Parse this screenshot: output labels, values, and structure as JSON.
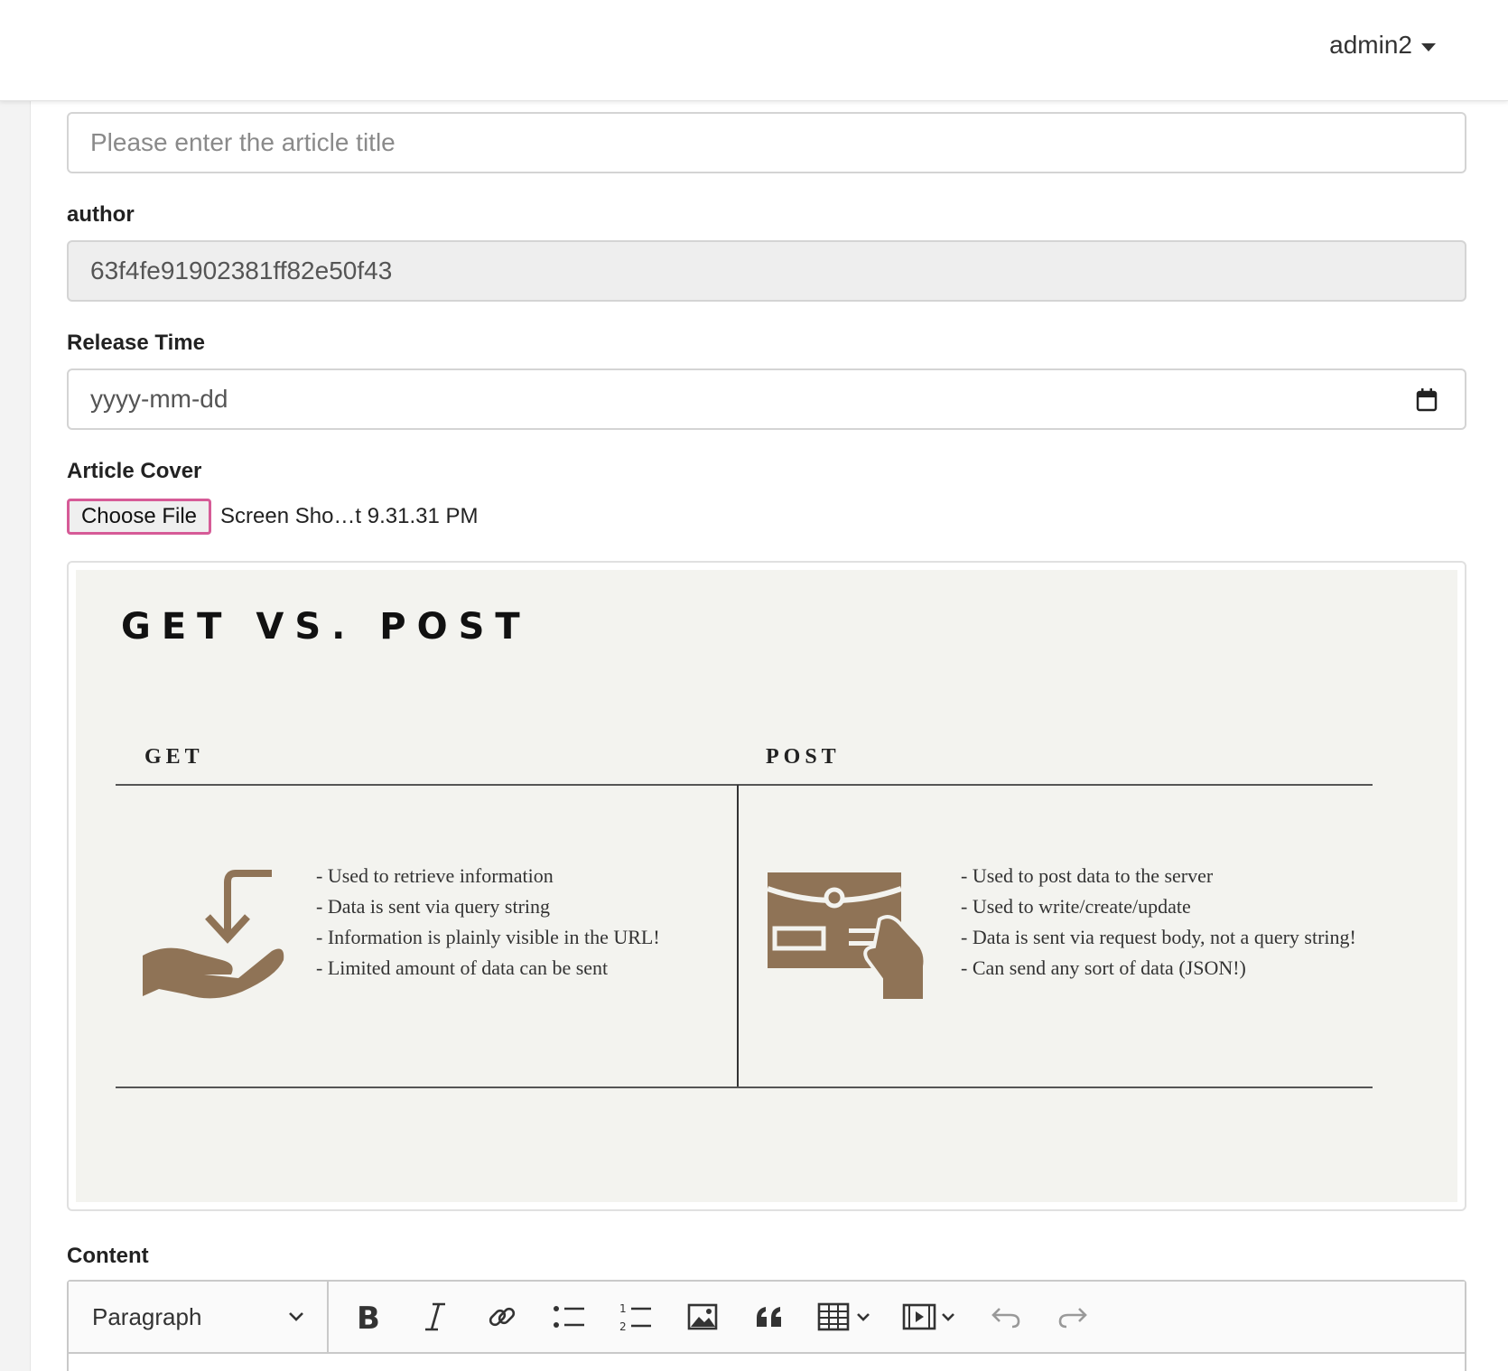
{
  "header": {
    "user": "admin2"
  },
  "form": {
    "title_placeholder": "Please enter the article title",
    "author_label": "author",
    "author_value": "63f4fe91902381ff82e50f43",
    "release_label": "Release Time",
    "release_placeholder": "yyyy-mm-dd",
    "cover_label": "Article Cover",
    "choose_file": "Choose File",
    "file_name": "Screen Sho…t 9.31.31 PM",
    "content_label": "Content"
  },
  "cover_image": {
    "title": "GET VS. POST",
    "get_heading": "GET",
    "post_heading": "POST",
    "get_points": [
      "- Used to retrieve information",
      "- Data is sent via query string",
      "- Information is plainly visible in the URL!",
      "- Limited amount of data can be sent"
    ],
    "post_points": [
      "- Used to post data to the server",
      "- Used to write/create/update",
      "- Data is sent via request body, not a query string!",
      "- Can send any sort of data (JSON!)"
    ],
    "icon_color": "#8f7356"
  },
  "editor": {
    "block_format": "Paragraph",
    "tools": [
      "bold-icon",
      "italic-icon",
      "link-icon",
      "bulleted-list-icon",
      "numbered-list-icon",
      "image-icon",
      "blockquote-icon",
      "table-icon",
      "media-icon",
      "undo-icon",
      "redo-icon"
    ]
  }
}
